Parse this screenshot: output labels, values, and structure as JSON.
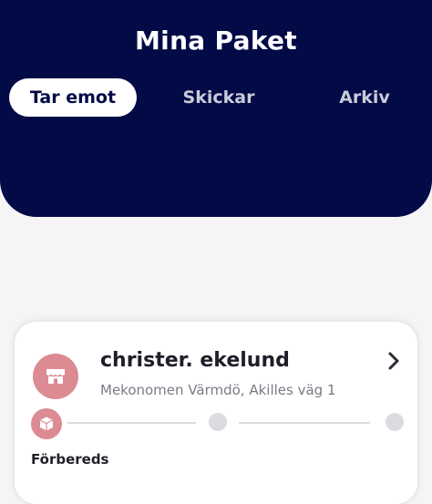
{
  "header": {
    "title": "Mina Paket",
    "tabs": [
      {
        "label": "Tar emot",
        "active": true
      },
      {
        "label": "Skickar",
        "active": false
      },
      {
        "label": "Arkiv",
        "active": false
      }
    ]
  },
  "parcel": {
    "sender": "christer. ekelund",
    "pickup_location": "Mekonomen Värmdö, Akilles väg 1",
    "status": "Förbereds",
    "store_icon": "store-icon",
    "box_icon": "package-icon",
    "chevron_icon": "chevron-right-icon",
    "progress": {
      "steps_total": 3,
      "current_step": 1
    }
  },
  "colors": {
    "header_bg": "#030b47",
    "accent_pink": "#dc8b93",
    "page_bg": "#f5f5f6"
  }
}
